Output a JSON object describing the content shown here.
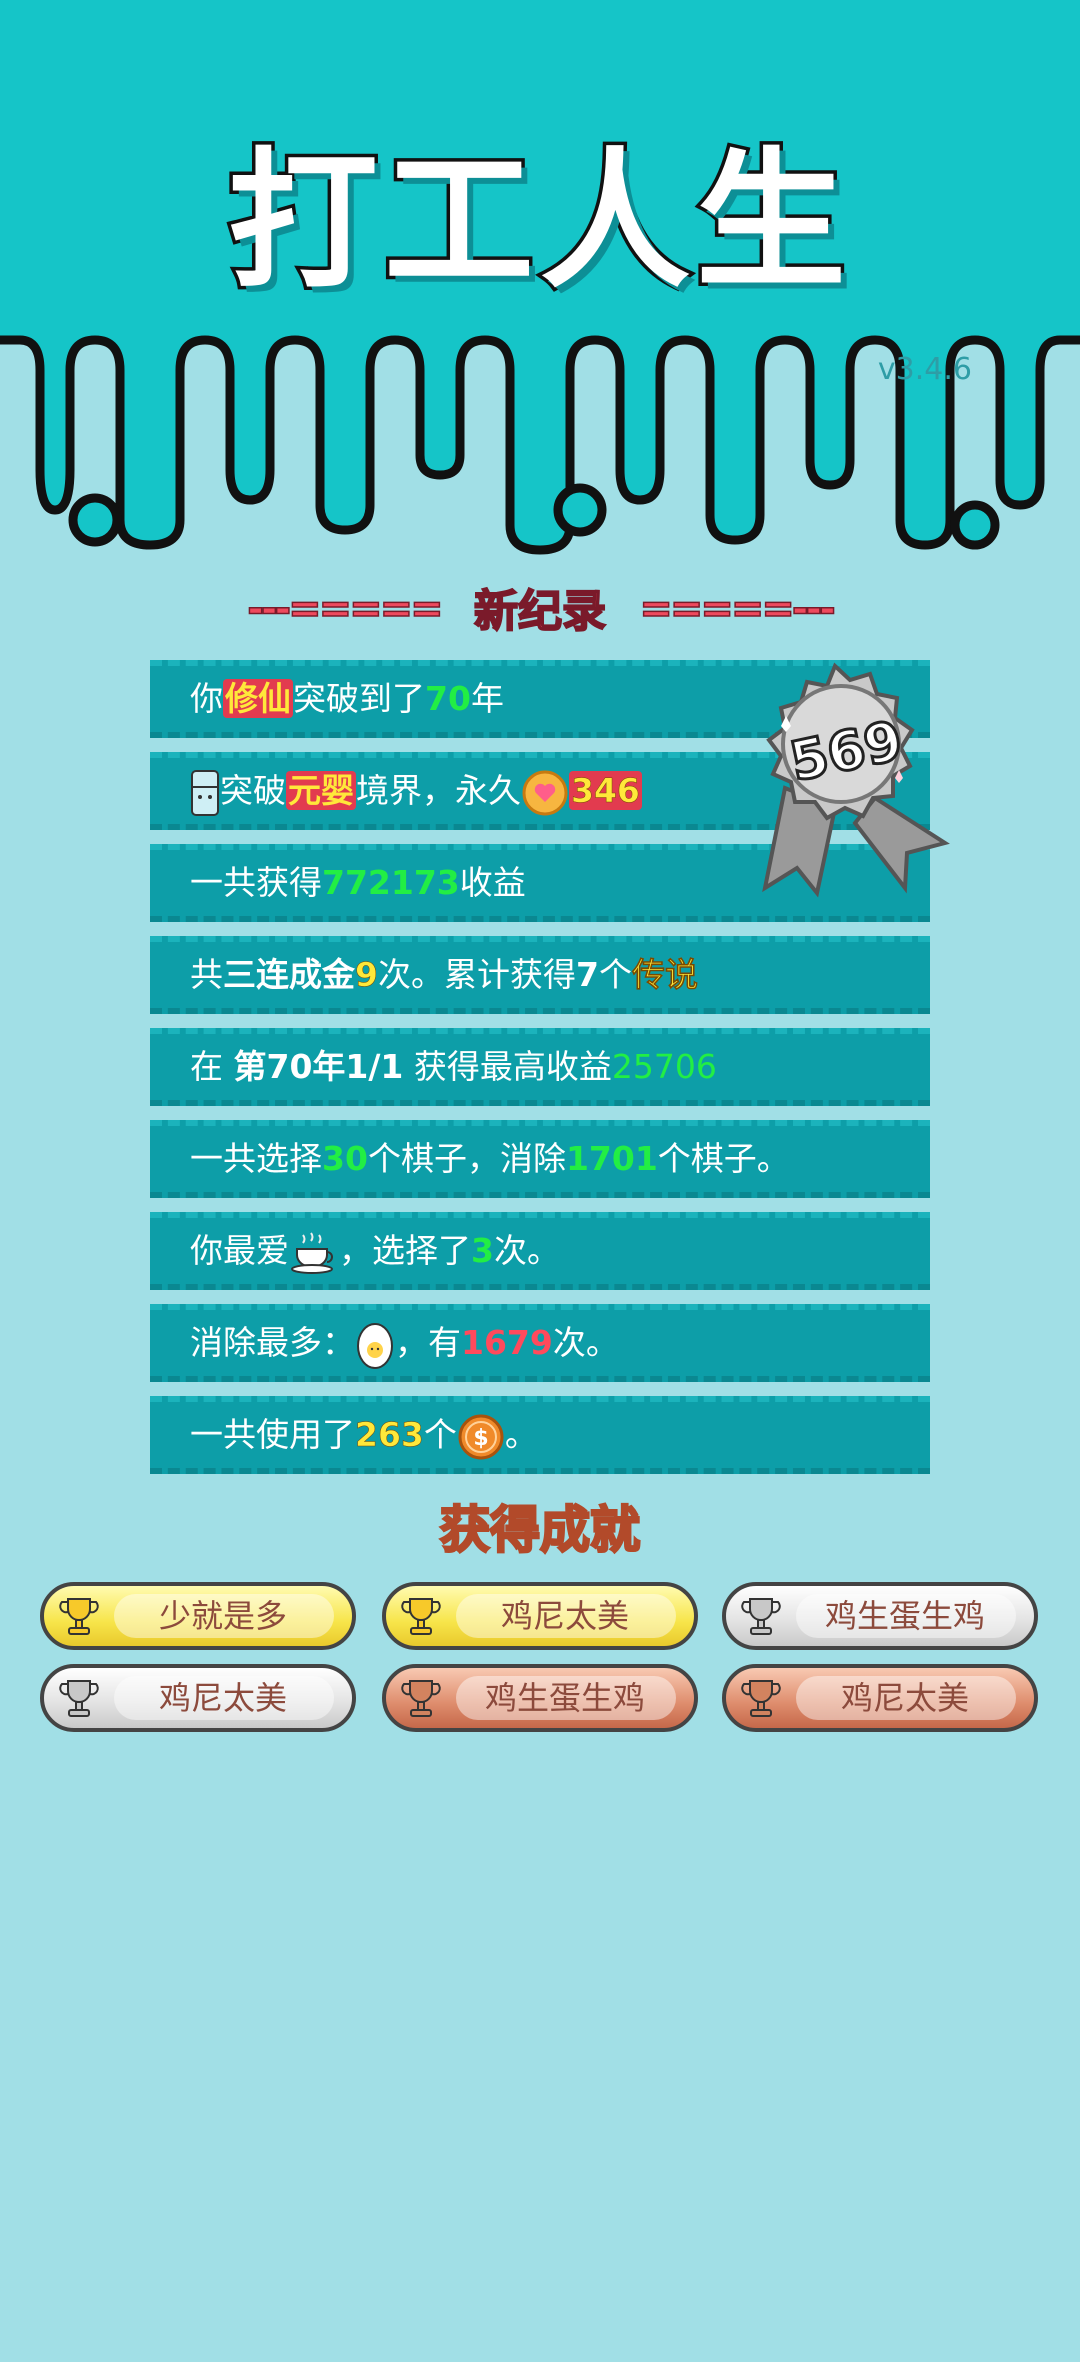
{
  "header": {
    "title": "打工人生",
    "version": "v3.4.6"
  },
  "record": {
    "dashes_left": "---=====",
    "title": "新纪录",
    "dashes_right": "=====---",
    "medal_value": "569"
  },
  "stats": [
    {
      "p1": "你",
      "h1": "修仙",
      "p2": "突破到了",
      "n1": "70",
      "p3": "年"
    },
    {
      "p1": "突破",
      "h1": "元婴",
      "p2": "境界，永久",
      "n1": "346"
    },
    {
      "p1": "一共获得",
      "n1": "772173",
      "p2": "收益"
    },
    {
      "p1": "共",
      "h1": "三连成金",
      "n1": "9",
      "p2": "次。累计获得",
      "n2": "7",
      "p3": "个",
      "h2": "传说"
    },
    {
      "p1": "在 ",
      "h1": "第70年1/1",
      "p2": " 获得最高收益",
      "n1": "25706"
    },
    {
      "p1": "一共选择",
      "n1": "30",
      "p2": "个棋子，消除",
      "n2": "1701",
      "p3": "个棋子。"
    },
    {
      "p1": "你最爱",
      "p2": "，选择了",
      "n1": "3",
      "p3": "次。"
    },
    {
      "p1": "消除最多：",
      "p2": "，有",
      "n1": "1679",
      "p3": "次。"
    },
    {
      "p1": "一共使用了",
      "n1": "263",
      "p2": "个",
      "p3": "。"
    }
  ],
  "achievements": {
    "title": "获得成就",
    "items": [
      {
        "label": "少就是多",
        "tier": "gold"
      },
      {
        "label": "鸡尼太美",
        "tier": "gold"
      },
      {
        "label": "鸡生蛋生鸡",
        "tier": "silver"
      },
      {
        "label": "鸡尼太美",
        "tier": "silver"
      },
      {
        "label": "鸡生蛋生鸡",
        "tier": "bronze"
      },
      {
        "label": "鸡尼太美",
        "tier": "bronze"
      }
    ]
  },
  "colors": {
    "background": "#a1dfe6",
    "header": "#15c5c8",
    "row": "#0d9ea8",
    "accent_yellow": "#ffe83a",
    "accent_green": "#22ee44",
    "accent_red": "#ff4a5c"
  },
  "icons": [
    "fridge-icon",
    "heart-coin-icon",
    "teacup-icon",
    "egg-icon",
    "dollar-coin-icon",
    "trophy-icon",
    "medal-icon"
  ]
}
